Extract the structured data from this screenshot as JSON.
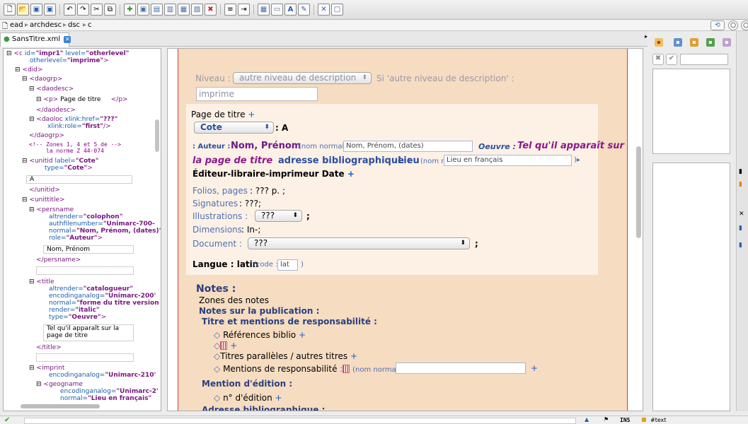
{
  "toolbar": {
    "icons": [
      "new-doc-icon",
      "open-folder-icon",
      "save-icon",
      "save-as-icon",
      "undo-icon",
      "redo-icon",
      "cut-icon",
      "copy-icon",
      "paste-icon",
      "insert-icon",
      "element-icon",
      "element2-icon",
      "element3-icon",
      "delete-icon",
      "align-left-icon",
      "align-right-icon",
      "table-icon",
      "comment-icon",
      "text-a-icon",
      "edit-icon",
      "validate-icon",
      "window-icon"
    ],
    "glyphs": [
      "🗋",
      "📂",
      "💾",
      "💾",
      "↶",
      "↷",
      "✂",
      "⧉",
      "📋",
      "✚",
      "▣",
      "▣",
      "▣",
      "▣",
      "✖",
      "≡",
      "⇥",
      "▦",
      "💬",
      "A",
      "✎",
      "✖",
      "▢"
    ]
  },
  "breadcrumb": {
    "items": [
      "ead",
      "archdesc",
      "dsc",
      "c"
    ],
    "sep": "▸"
  },
  "tab": {
    "label": "SansTitre.xml",
    "close": "✕"
  },
  "tree": {
    "l1_tag": "<c",
    "l1_a1": "id=",
    "l1_v1": "\"impr1\"",
    "l1_a2": "level=",
    "l1_v2": "\"otherlevel\"",
    "l2_a": "otherlevel=",
    "l2_v": "\"imprime\"",
    "l2_end": ">",
    "did": "<did>",
    "daogrp": "<daogrp>",
    "daodesc": "<daodesc>",
    "p_open": "<p>",
    "p_text": "Page de titre",
    "p_close": "</p>",
    "daodesc_close": "</daodesc>",
    "daoloc": "<daoloc",
    "daoloc_a": "xlink:href=",
    "daoloc_v": "\"???\"",
    "daoloc_a2": "xlink:role=",
    "daoloc_v2": "\"first\"",
    "daoloc_end": "/>",
    "daogrp_close": "</daogrp>",
    "comment1": "<!-- Zones 1, 4 et 5 de",
    "comment2": "la norme Z 44-074",
    "comment_end": "-->",
    "unitid": "<unitid",
    "unitid_a": "label=",
    "unitid_v": "\"Cote\"",
    "unitid_a2": "type=",
    "unitid_v2": "\"Cote\"",
    "unitid_end": ">",
    "unitid_text": "A",
    "unitid_close": "</unitid>",
    "unittitle": "<unittitle>",
    "persname": "<persname",
    "pn_a1": "altrender=",
    "pn_v1": "\"colophon\"",
    "pn_a2": "authfilenumber=",
    "pn_v2": "\"Unimarc-700-",
    "pn_a3": "normal=",
    "pn_v3": "\"Nom, Prénom, (dates)\"",
    "pn_a4": "role=",
    "pn_v4": "\"Auteur\"",
    "pn_end": ">",
    "pn_text": "Nom, Prénom",
    "pn_close": "</persname>",
    "title": "<title",
    "ti_a1": "altrender=",
    "ti_v1": "\"catalogueur\"",
    "ti_a2": "encodinganalog=",
    "ti_v2": "\"Unimarc-200'",
    "ti_a3": "normal=",
    "ti_v3": "\"forme du titre version",
    "ti_a4": "render=",
    "ti_v4": "\"italic\"",
    "ti_a5": "type=",
    "ti_v5": "\"Oeuvre\"",
    "ti_end": ">",
    "ti_text1": "Tel qu'il apparaît sur la",
    "ti_text2": "page de titre",
    "ti_close": "</title>",
    "imprint": "<imprint",
    "im_a": "encodinganalog=",
    "im_v": "\"Unimarc-210'",
    "geogname": "<geogname",
    "geo_a1": "encodinganalog=",
    "geo_v1": "\"Unimarc-2'",
    "geo_a2": "normal=",
    "geo_v2": "\"Lieu en français\""
  },
  "form": {
    "niveau_label": "Niveau :",
    "niveau_select": "autre niveau de description",
    "niveau_hint": "Si 'autre niveau de description' :",
    "niveau_input": "imprime",
    "page_titre": "Page de titre",
    "plus": "+",
    "cote_select": "Cote",
    "cote_value": ": A",
    "auteur_label": ": Auteur :",
    "auteur_name": "Nom, Prénom",
    "nom_normal": "(nom normal",
    "auteur_normal": "Nom, Prénom, (dates)",
    "oeuvre_label": "Oeuvre :",
    "oeuvre_title_1": "Tel qu'il apparaît sur",
    "oeuvre_title_2": "la page de titre",
    "adresse_label": "adresse bibliographique :",
    "lieu": "Lieu",
    "lieu_normal": "Lieu en français",
    "lieu_arrow": ")▸",
    "editeur": "Éditeur-libraire-imprimeur Date",
    "folios_label": "Folios, pages",
    "folios_value": ": ??? p. ;",
    "signatures_label": "Signatures",
    "signatures_value": ": ???;",
    "illustrations_label": "Illustrations :",
    "illustrations_select": "???",
    "semicolon": ";",
    "dimensions_label": "Dimensions",
    "dimensions_value": ": In-;",
    "document_label": "Document :",
    "document_select": "???",
    "langue_label": "Langue : latin",
    "code_label": "(code :",
    "code_value": "lat",
    "code_end": ")",
    "notes_title": "Notes :",
    "zones_notes": "Zones des notes",
    "notes_publication": "Notes sur la publication :",
    "titre_mentions": "Titre et mentions de responsabilité :",
    "refs_biblio": "Références biblio",
    "titres_paralleles": "Titres parallèles / autres titres",
    "mentions_resp": "Mentions de responsabilité",
    "colon_sp": ":",
    "mention_edition": "Mention d'édition :",
    "no_edition": "n° d'édition",
    "adresse_biblio": "Adresse bibliographique :",
    "bullet": "◇",
    "fold": "⊟"
  },
  "right_panel": {
    "icons": [
      "✖",
      "✔"
    ]
  },
  "status": {
    "check": "✔",
    "ins": "INS",
    "node": "#text"
  }
}
